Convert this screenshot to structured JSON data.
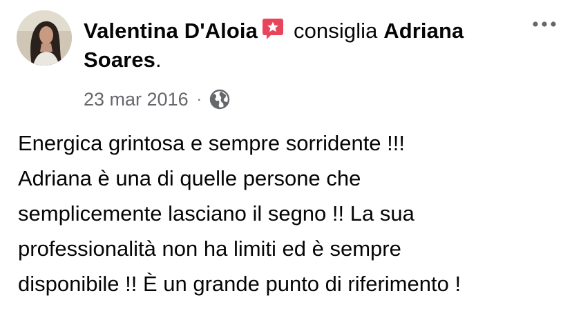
{
  "post": {
    "author": "Valentina D'Aloia",
    "action": "consiglia",
    "target": "Adriana Soares",
    "period": ".",
    "date": "23 mar 2016",
    "separator": "·",
    "audience_icon": "globe-icon",
    "recommend_icon": "recommendation-badge-icon",
    "more_icon": "more-options-icon",
    "body": "Energica grintosa e sempre sorridente !!!\nAdriana è una di quelle persone che\nsemplicemente lasciano il segno !! La sua\nprofessionalità non ha limiti ed è sempre\ndisponibile !! È un grande punto di riferimento !"
  },
  "colors": {
    "text": "#050505",
    "secondary": "#65676b",
    "badge": "#e8455c"
  }
}
